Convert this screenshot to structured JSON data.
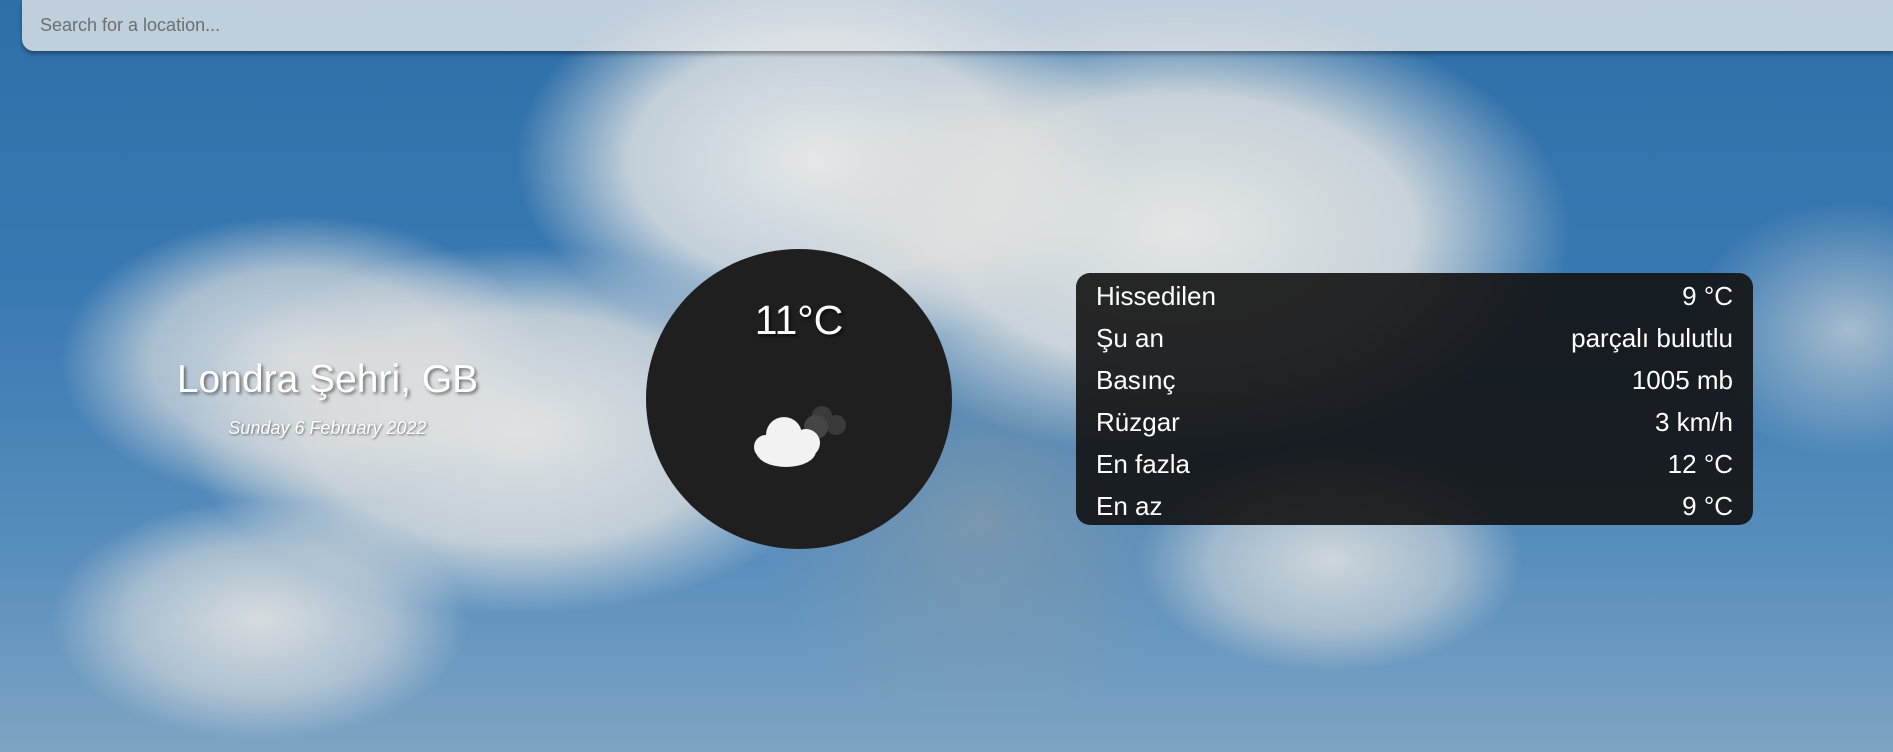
{
  "search": {
    "placeholder": "Search for a location...",
    "value": ""
  },
  "location": {
    "city": "Londra Şehri, GB",
    "date": "Sunday 6 February 2022"
  },
  "current": {
    "temperature": "11°C",
    "icon": "partly-cloudy-icon"
  },
  "details": [
    {
      "label": "Hissedilen",
      "value": "9 °C"
    },
    {
      "label": "Şu an",
      "value": "parçalı bulutlu"
    },
    {
      "label": "Basınç",
      "value": "1005 mb"
    },
    {
      "label": "Rüzgar",
      "value": "3 km/h"
    },
    {
      "label": "En fazla",
      "value": "12 °C"
    },
    {
      "label": "En az",
      "value": "9 °C"
    }
  ],
  "colors": {
    "panel": "#1f1f1f",
    "text": "#ffffff",
    "search_bar": "#e1e4e6"
  }
}
